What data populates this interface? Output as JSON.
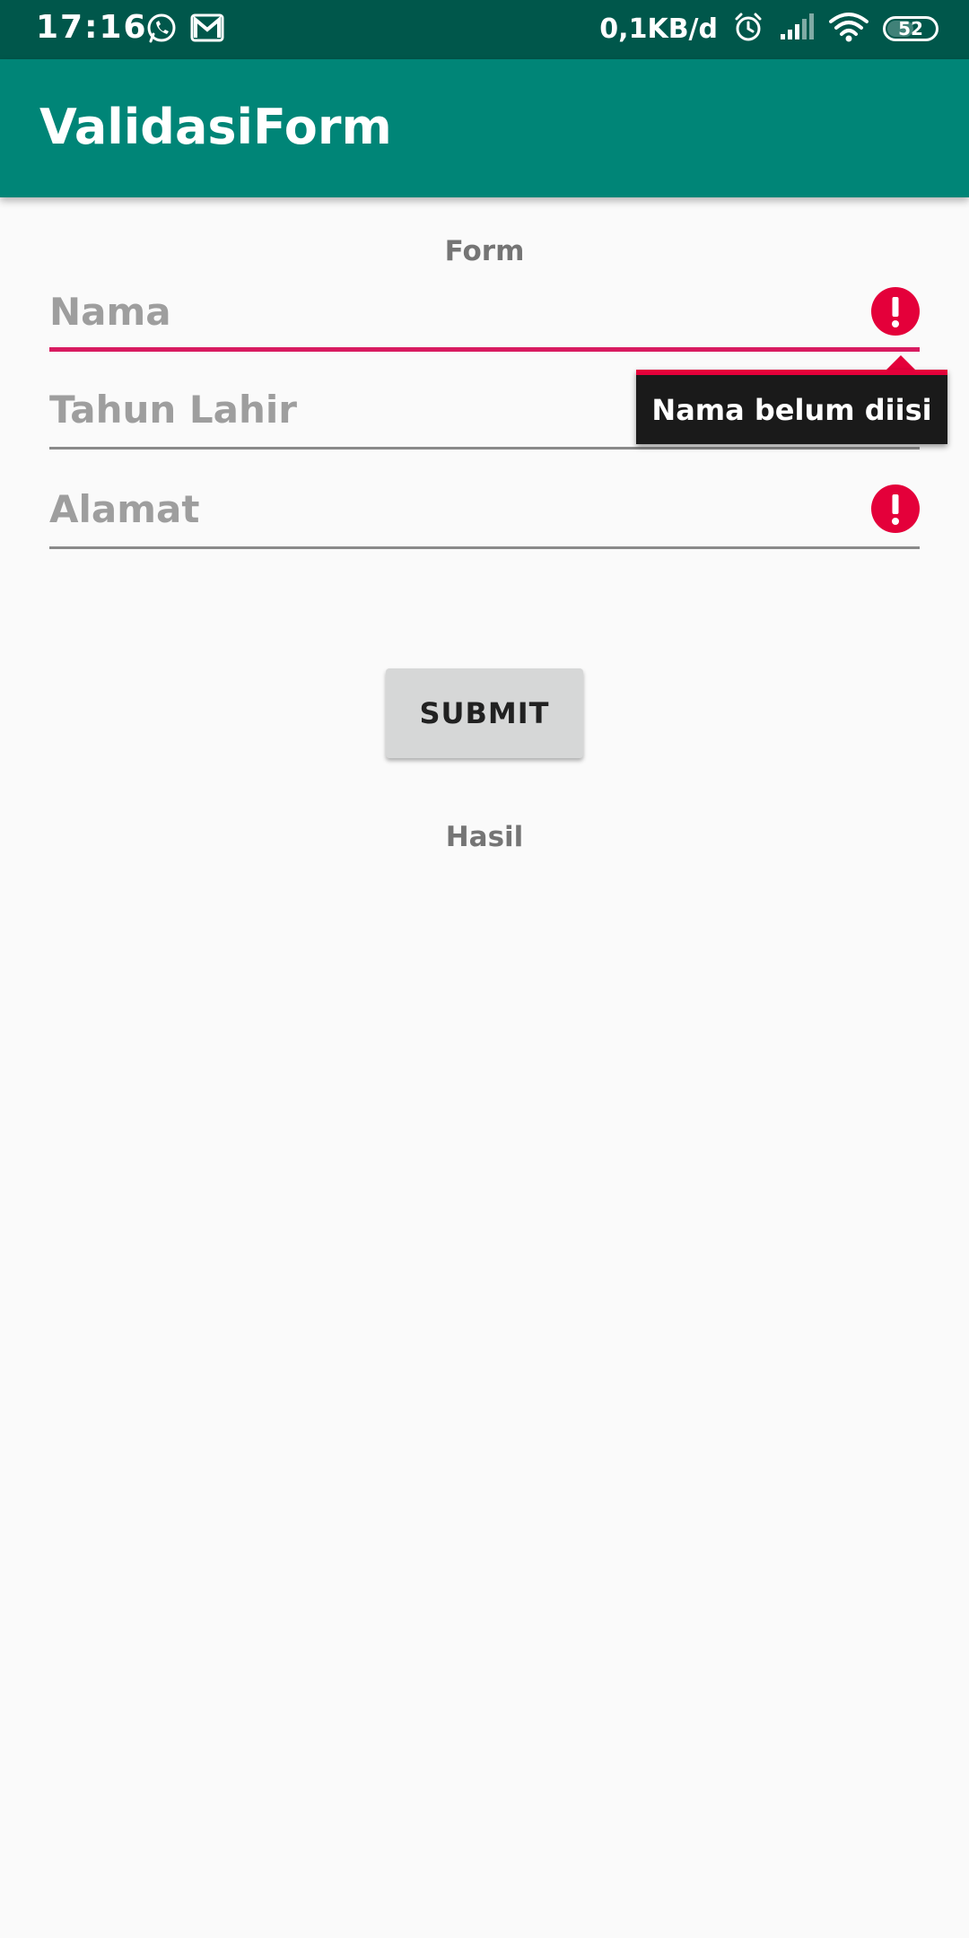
{
  "status_bar": {
    "time": "17:16",
    "left_icons": [
      "whatsapp-icon",
      "gmail-icon"
    ],
    "network_speed": "0,1KB/d",
    "right_icons": [
      "alarm-icon",
      "signal-icon",
      "wifi-icon"
    ],
    "battery_level": "52"
  },
  "app_bar": {
    "title": "ValidasiForm"
  },
  "form": {
    "heading": "Form",
    "fields": [
      {
        "name": "nama",
        "placeholder": "Nama",
        "value": "",
        "error": true
      },
      {
        "name": "tahun_lahir",
        "placeholder": "Tahun Lahir",
        "value": "",
        "error": true
      },
      {
        "name": "alamat",
        "placeholder": "Alamat",
        "value": "",
        "error": true
      }
    ],
    "error_tooltip": "Nama belum diisi",
    "submit_label": "SUBMIT",
    "result_label": "Hasil"
  },
  "colors": {
    "status_bar": "#00574B",
    "app_bar": "#008577",
    "accent": "#D81B60",
    "error": "#E4003A",
    "background": "#FAFAFA"
  }
}
